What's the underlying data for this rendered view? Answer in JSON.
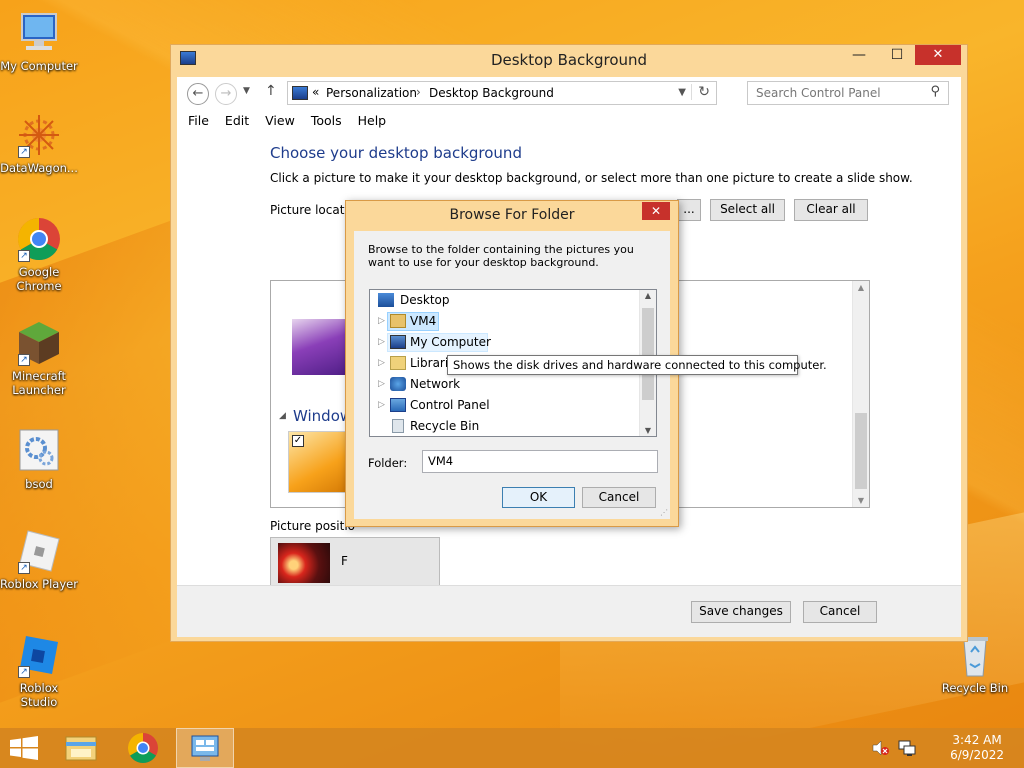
{
  "desktop": {
    "icons": [
      {
        "label": "My Computer"
      },
      {
        "label": "DataWagon..."
      },
      {
        "label": "Google Chrome"
      },
      {
        "label": "Minecraft Launcher"
      },
      {
        "label": "bsod"
      },
      {
        "label": "Roblox Player"
      },
      {
        "label": "Roblox Studio"
      },
      {
        "label": "Recycle Bin"
      }
    ]
  },
  "window": {
    "title": "Desktop Background",
    "minimize": "—",
    "maximize": "☐",
    "close": "✕",
    "address": {
      "prefix": "«",
      "crumb1": "Personalization",
      "separator": "›",
      "crumb2": "Desktop Background"
    },
    "search_placeholder": "Search Control Panel",
    "menu": [
      "File",
      "Edit",
      "View",
      "Tools",
      "Help"
    ],
    "content": {
      "heading": "Choose your desktop background",
      "description": "Click a picture to make it your desktop background, or select more than one picture to create a slide show.",
      "picture_location_label": "Picture locatio",
      "browse_button": "...",
      "select_all": "Select all",
      "clear_all": "Clear all",
      "group_label": "Window",
      "picture_position_label": "Picture positio",
      "position_value": "F"
    },
    "footer": {
      "save": "Save changes",
      "cancel": "Cancel"
    }
  },
  "dialog": {
    "title": "Browse For Folder",
    "close": "✕",
    "instruction": "Browse to the folder containing the pictures you want to use for your desktop background.",
    "tree": [
      {
        "label": "Desktop",
        "indent": 0,
        "selected": false
      },
      {
        "label": "VM4",
        "indent": 1,
        "selected": true
      },
      {
        "label": "My Computer",
        "indent": 1,
        "selected": false,
        "hover": true
      },
      {
        "label": "Librarie",
        "indent": 1,
        "selected": false
      },
      {
        "label": "Network",
        "indent": 1,
        "selected": false
      },
      {
        "label": "Control Panel",
        "indent": 1,
        "selected": false
      },
      {
        "label": "Recycle Bin",
        "indent": 1,
        "selected": false
      }
    ],
    "folder_label": "Folder:",
    "folder_value": "VM4",
    "ok": "OK",
    "cancel": "Cancel"
  },
  "tooltip": "Shows the disk drives and hardware connected to this computer.",
  "taskbar": {
    "time": "3:42 AM",
    "date": "6/9/2022"
  }
}
